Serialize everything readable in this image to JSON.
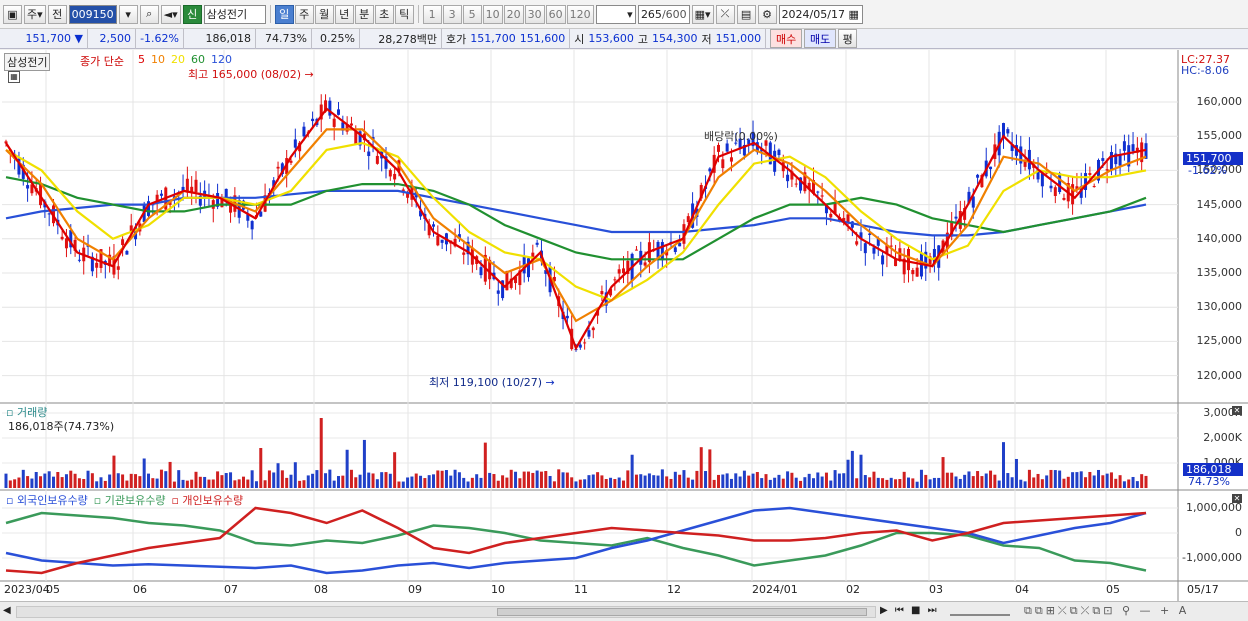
{
  "toolbar": {
    "mode_1": "주",
    "mode_2": "전",
    "stock_code": "009150",
    "stock_badge": "신",
    "stock_name": "삼성전기",
    "periods": [
      "일",
      "주",
      "월",
      "년",
      "분",
      "초",
      "틱"
    ],
    "periods_active": "일",
    "intervals": [
      "1",
      "3",
      "5",
      "10",
      "20",
      "30",
      "60",
      "120"
    ],
    "count": "265",
    "count_total": "/600",
    "date": "2024/05/17"
  },
  "quote": {
    "price": "151,700",
    "change": "2,500",
    "change_pct": "-1.62%",
    "volume": "186,018",
    "volume_ratio": "74.73%",
    "turnover": "0.25%",
    "amount": "28,278백만",
    "bid_label": "호가",
    "bid1": "151,700",
    "bid2": "151,600",
    "open_label": "시",
    "open": "153,600",
    "high_label": "고",
    "high": "154,300",
    "low_label": "저",
    "low": "151,000",
    "buy_label": "매수",
    "sell_label": "매도",
    "eval_label": "평"
  },
  "price_panel": {
    "name": "삼성전기",
    "legend_title": "종가 단순",
    "ma_periods": [
      "5",
      "10",
      "20",
      "60",
      "120"
    ],
    "ma_colors": [
      "#dd0000",
      "#f08000",
      "#f0e000",
      "#209030",
      "#2850d8"
    ],
    "lc": "LC:27.37",
    "hc": "HC:-8.06",
    "high_annotation": "최고 165,000 (08/02)",
    "low_annotation": "최저 119,100 (10/27)",
    "dividend_annotation": "배당락(0.00%)",
    "current_price": "151,700",
    "current_pct": "-1.62%",
    "y_ticks": [
      "160,000",
      "155,000",
      "150,000",
      "145,000",
      "140,000",
      "135,000",
      "130,000",
      "125,000",
      "120,000"
    ]
  },
  "volume_panel": {
    "title": "거래량",
    "value": "186,018주(74.73%)",
    "y_ticks": [
      "3,000K",
      "2,000K",
      "1,000K"
    ],
    "current": "186,018",
    "current_pct": "74.73%"
  },
  "holdings_panel": {
    "series": [
      "외국인보유수량",
      "기관보유수량",
      "개인보유수량"
    ],
    "colors": [
      "#2a50d8",
      "#3a9a5a",
      "#cf2020"
    ],
    "y_ticks": [
      "1,000,000",
      "0",
      "-1,000,000"
    ]
  },
  "x_axis": [
    "2023/04",
    "05",
    "06",
    "07",
    "08",
    "09",
    "10",
    "11",
    "12",
    "2024/01",
    "02",
    "03",
    "04",
    "05",
    "05/17"
  ],
  "chart_data": [
    {
      "type": "line",
      "title": "삼성전기 종가 단순 이동평균",
      "ylim": [
        117000,
        163000
      ],
      "series": [
        {
          "name": "5",
          "values": [
            154000,
            146000,
            138000,
            136000,
            145000,
            147000,
            146000,
            143000,
            152000,
            159000,
            155000,
            150000,
            141000,
            138000,
            133000,
            138000,
            124000,
            133000,
            138000,
            140000,
            152000,
            154000,
            150000,
            145000,
            140000,
            137000,
            136000,
            145000,
            155000,
            150000,
            146000,
            152000,
            153000
          ]
        },
        {
          "name": "10",
          "values": [
            153000,
            148000,
            140000,
            137000,
            143000,
            147000,
            146000,
            144000,
            150000,
            156000,
            156000,
            151000,
            143000,
            139000,
            135000,
            137000,
            128000,
            131000,
            136000,
            140000,
            149000,
            153000,
            151000,
            147000,
            142000,
            138000,
            136000,
            142000,
            152000,
            151000,
            147000,
            150000,
            152000
          ]
        },
        {
          "name": "20",
          "values": [
            153000,
            150000,
            144000,
            140000,
            142000,
            146000,
            146000,
            145000,
            147000,
            153000,
            154000,
            152000,
            146000,
            141000,
            138000,
            137000,
            133000,
            131000,
            134000,
            138000,
            145000,
            151000,
            152000,
            149000,
            144000,
            140000,
            137000,
            139000,
            147000,
            150000,
            149000,
            149000,
            150000
          ]
        },
        {
          "name": "60",
          "values": [
            149000,
            148000,
            146000,
            145000,
            144000,
            144000,
            145000,
            145000,
            145000,
            147000,
            148000,
            148000,
            147000,
            145000,
            142000,
            140000,
            138000,
            137000,
            137000,
            137000,
            140000,
            143000,
            145000,
            145000,
            146000,
            145000,
            143000,
            142000,
            141000,
            142000,
            143000,
            144000,
            146000
          ]
        },
        {
          "name": "120",
          "values": [
            143000,
            144000,
            144500,
            145000,
            145000,
            146000,
            146000,
            146000,
            146500,
            147000,
            147000,
            147000,
            146000,
            145000,
            144000,
            143000,
            142000,
            141000,
            141000,
            141000,
            141500,
            142000,
            143000,
            143000,
            142000,
            141000,
            140500,
            140500,
            141000,
            142000,
            143000,
            144000,
            145000
          ]
        }
      ]
    }
  ]
}
